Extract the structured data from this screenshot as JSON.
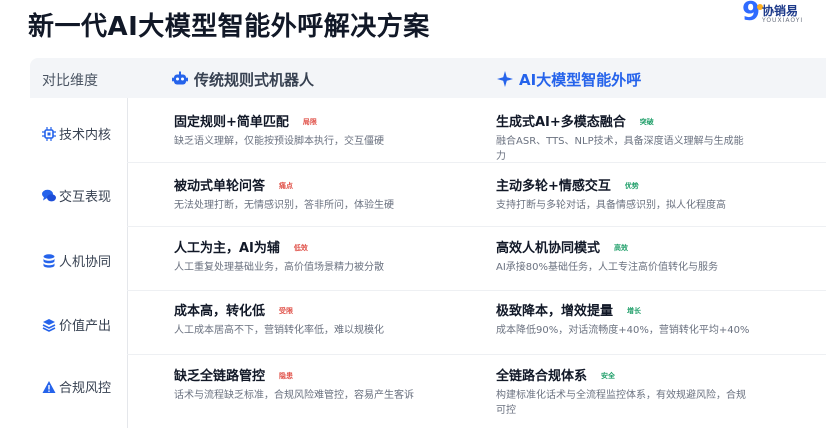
{
  "page": {
    "title": "新一代AI大模型智能外呼解决方案"
  },
  "logo": {
    "glyph": "9",
    "name": "协销易",
    "sub": "YOUXIAOYI"
  },
  "colors": {
    "accent": "#2563eb",
    "risk_tag": "#e0524a",
    "advantage_tag": "#22a06b",
    "header_bg": "#f3f5f8"
  },
  "table": {
    "header": {
      "dimension": "对比维度",
      "left": "传统规则式机器人",
      "right": "AI大模型智能外呼",
      "left_icon": "robot-icon",
      "right_icon": "ai-sparkle-icon"
    },
    "rows": [
      {
        "dimension": "技术内核",
        "icon": "chip-icon",
        "left": {
          "title": "固定规则+简单匹配",
          "tag": "局限",
          "desc": "缺乏语义理解，仅能按预设脚本执行，交互僵硬"
        },
        "right": {
          "title": "生成式AI+多模态融合",
          "tag": "突破",
          "desc": "融合ASR、TTS、NLP技术，具备深度语义理解与生成能力"
        }
      },
      {
        "dimension": "交互表现",
        "icon": "chat-icon",
        "left": {
          "title": "被动式单轮问答",
          "tag": "痛点",
          "desc": "无法处理打断，无情感识别，答非所问，体验生硬"
        },
        "right": {
          "title": "主动多轮+情感交互",
          "tag": "优势",
          "desc": "支持打断与多轮对话，具备情感识别，拟人化程度高"
        }
      },
      {
        "dimension": "人机协同",
        "icon": "database-icon",
        "left": {
          "title": "人工为主，AI为辅",
          "tag": "低效",
          "desc": "人工重复处理基础业务，高价值场景精力被分散"
        },
        "right": {
          "title": "高效人机协同模式",
          "tag": "高效",
          "desc": "AI承接80%基础任务，人工专注高价值转化与服务"
        }
      },
      {
        "dimension": "价值产出",
        "icon": "layers-icon",
        "left": {
          "title": "成本高，转化低",
          "tag": "受限",
          "desc": "人工成本居高不下，营销转化率低，难以规模化"
        },
        "right": {
          "title": "极致降本，增效提量",
          "tag": "增长",
          "desc": "成本降低90%，对话流畅度+40%，营销转化平均+40%"
        }
      },
      {
        "dimension": "合规风控",
        "icon": "warning-icon",
        "left": {
          "title": "缺乏全链路管控",
          "tag": "隐患",
          "desc": "话术与流程缺乏标准，合规风险难管控，容易产生客诉"
        },
        "right": {
          "title": "全链路合规体系",
          "tag": "安全",
          "desc": "构建标准化话术与全流程监控体系，有效规避风险，合规可控"
        }
      }
    ]
  }
}
